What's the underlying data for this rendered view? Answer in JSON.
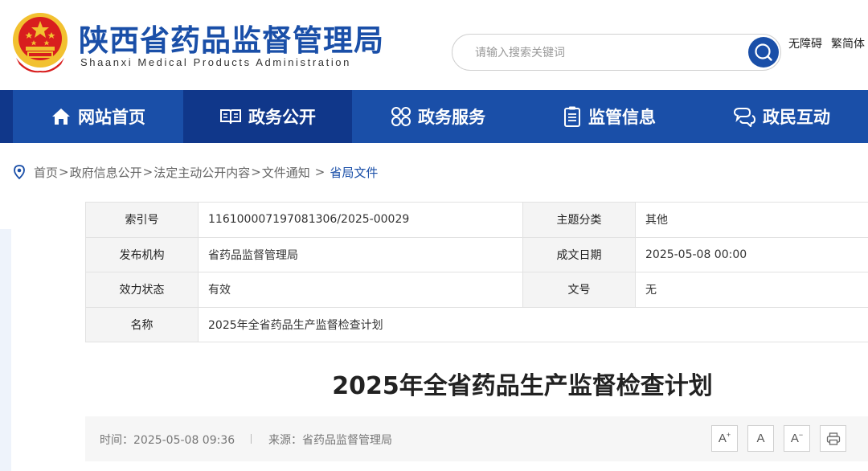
{
  "header": {
    "site_name_cn": "陕西省药品监督管理局",
    "site_name_en": "Shaanxi Medical Products Administration",
    "emblem_icon": "national-emblem-icon",
    "search": {
      "placeholder": "请输入搜索关键词",
      "value": ""
    },
    "links": {
      "accessibility": "无障碍",
      "traditional": "繁简体"
    }
  },
  "nav": {
    "items": [
      {
        "label": "网站首页",
        "icon": "home-icon"
      },
      {
        "label": "政务公开",
        "icon": "open-book-icon"
      },
      {
        "label": "政务服务",
        "icon": "services-icon"
      },
      {
        "label": "监管信息",
        "icon": "clipboard-icon"
      },
      {
        "label": "政民互动",
        "icon": "interaction-icon"
      }
    ],
    "active_index": 1
  },
  "breadcrumb": {
    "icon": "location-pin-icon",
    "items": [
      "首页",
      "政府信息公开",
      "法定主动公开内容",
      "文件通知"
    ],
    "separator": ">",
    "current": "省局文件"
  },
  "meta": {
    "index_label": "索引号",
    "index_value": "116100007197081306/2025-00029",
    "topic_label": "主题分类",
    "topic_value": "其他",
    "issuer_label": "发布机构",
    "issuer_value": "省药品监督管理局",
    "date_label": "成文日期",
    "date_value": "2025-05-08 00:00",
    "status_label": "效力状态",
    "status_value": "有效",
    "docno_label": "文号",
    "docno_value": "无",
    "name_label": "名称",
    "name_value": "2025年全省药品生产监督检查计划"
  },
  "article": {
    "title": "2025年全省药品生产监督检查计划",
    "time": "时间：2025-05-08 09:36",
    "source": "来源：省药品监督管理局"
  },
  "tools": {
    "font_increase": "A",
    "font_increase_mark": "+",
    "font_default": "A",
    "font_decrease": "A",
    "font_decrease_mark": "−",
    "print_icon": "printer-icon"
  },
  "colors": {
    "brand_blue": "#1a4fa8",
    "nav_active": "#10378a",
    "emblem_red": "#d81e1e",
    "emblem_gold": "#f2c130"
  }
}
